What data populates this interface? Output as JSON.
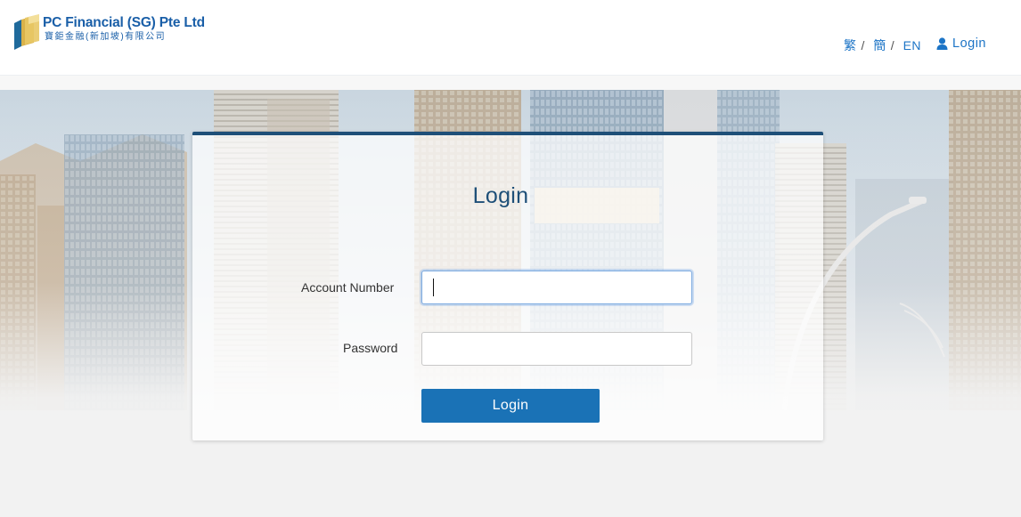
{
  "brand": {
    "name": "PC Financial (SG) Pte Ltd",
    "chinese_name": "寶鉅金融(新加坡)有限公司"
  },
  "nav": {
    "lang_traditional": "繁",
    "lang_simplified": "簡",
    "lang_english": "EN",
    "separator": "/",
    "login_label": "Login",
    "login_icon": "user-icon"
  },
  "form": {
    "title": "Login",
    "account_label": "Account Number",
    "account_value": "",
    "password_label": "Password",
    "password_value": "",
    "submit_label": "Login"
  },
  "colors": {
    "accent": "#1a72b6",
    "title": "#1e4f78",
    "link": "#1c74c6"
  }
}
